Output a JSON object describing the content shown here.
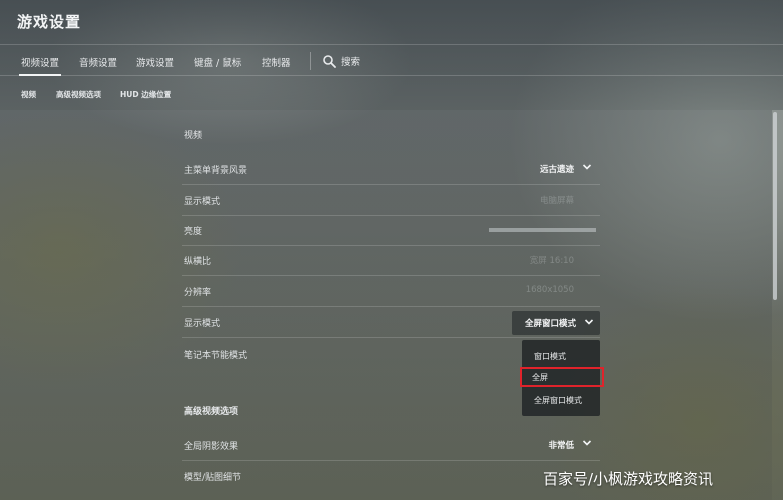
{
  "app": {
    "title": "游戏设置"
  },
  "main_tabs": [
    {
      "label": "视频设置",
      "active": true
    },
    {
      "label": "音频设置"
    },
    {
      "label": "游戏设置"
    },
    {
      "label": "键盘 / 鼠标"
    },
    {
      "label": "控制器"
    }
  ],
  "search": {
    "label": "搜索",
    "icon": "search-icon"
  },
  "sub_tabs": [
    {
      "label": "视频"
    },
    {
      "label": "高级视频选项"
    },
    {
      "label": "HUD 边缘位置"
    }
  ],
  "video_section": {
    "header": "视频",
    "rows": [
      {
        "label": "主菜单背景风景",
        "value": "远古遗迹"
      },
      {
        "label": "显示模式",
        "value": "电脑屏幕"
      },
      {
        "label": "亮度"
      },
      {
        "label": "纵横比",
        "value": "宽屏 16:10"
      },
      {
        "label": "分辨率",
        "value": "1680x1050"
      },
      {
        "label": "显示模式",
        "value": "全屏窗口模式"
      },
      {
        "label": "笔记本节能模式"
      }
    ]
  },
  "dropdown": {
    "options": [
      "窗口模式",
      "全屏",
      "全屏窗口模式"
    ],
    "highlighted": "全屏"
  },
  "advanced_section": {
    "header": "高级视频选项",
    "rows": [
      {
        "label": "全局阴影效果",
        "value": "非常低"
      },
      {
        "label": "模型/贴图细节"
      }
    ]
  },
  "watermark": "百家号/小枫游戏攻略资讯",
  "colors": {
    "highlight_outline": "#e0232b",
    "scrollbar": "#d2d6d8"
  }
}
